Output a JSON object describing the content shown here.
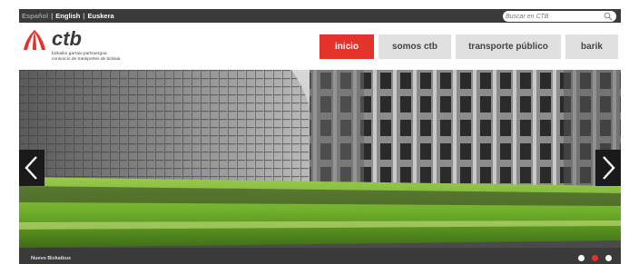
{
  "languages": {
    "es": "Español",
    "en": "English",
    "eu": "Euskera"
  },
  "search": {
    "placeholder": "Buscar en CTB"
  },
  "logo": {
    "name": "ctb",
    "subtitle_1": "bizkaiko garraio partzuergoa",
    "subtitle_2": "consorcio de transportes de bizkaia"
  },
  "nav": {
    "items": [
      {
        "label": "inicio",
        "active": true
      },
      {
        "label": "somos ctb",
        "active": false
      },
      {
        "label": "transporte público",
        "active": false
      },
      {
        "label": "barik",
        "active": false
      }
    ]
  },
  "hero": {
    "caption": "Nuevo Bizkaibus",
    "slides_total": 3,
    "slide_active": 2
  },
  "colors": {
    "accent": "#e4332a",
    "topbar": "#3a3a3a",
    "nav_bg": "#e0e0e0",
    "bus_green": "#7cb82f"
  },
  "icons": {
    "search": "search-icon",
    "prev": "chevron-left-icon",
    "next": "chevron-right-icon"
  }
}
